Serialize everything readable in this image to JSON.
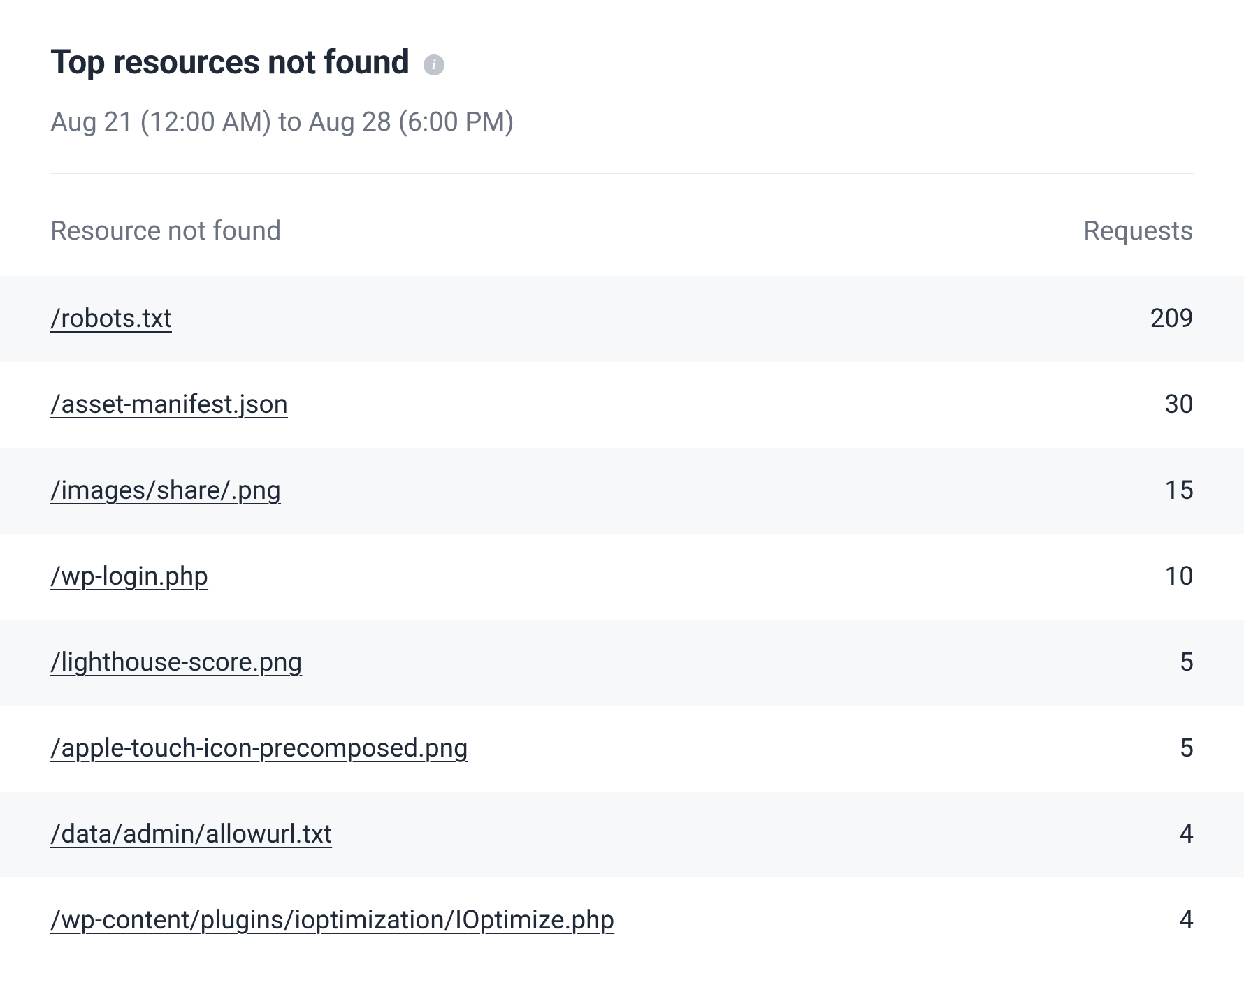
{
  "header": {
    "title": "Top resources not found",
    "date_range": "Aug 21 (12:00 AM) to Aug 28 (6:00 PM)"
  },
  "table": {
    "columns": {
      "resource": "Resource not found",
      "requests": "Requests"
    },
    "rows": [
      {
        "resource": "/robots.txt",
        "requests": "209"
      },
      {
        "resource": "/asset-manifest.json",
        "requests": "30"
      },
      {
        "resource": "/images/share/.png",
        "requests": "15"
      },
      {
        "resource": "/wp-login.php",
        "requests": "10"
      },
      {
        "resource": "/lighthouse-score.png",
        "requests": "5"
      },
      {
        "resource": "/apple-touch-icon-precomposed.png",
        "requests": "5"
      },
      {
        "resource": "/data/admin/allowurl.txt",
        "requests": "4"
      },
      {
        "resource": "/wp-content/plugins/ioptimization/IOptimize.php",
        "requests": "4"
      }
    ]
  }
}
